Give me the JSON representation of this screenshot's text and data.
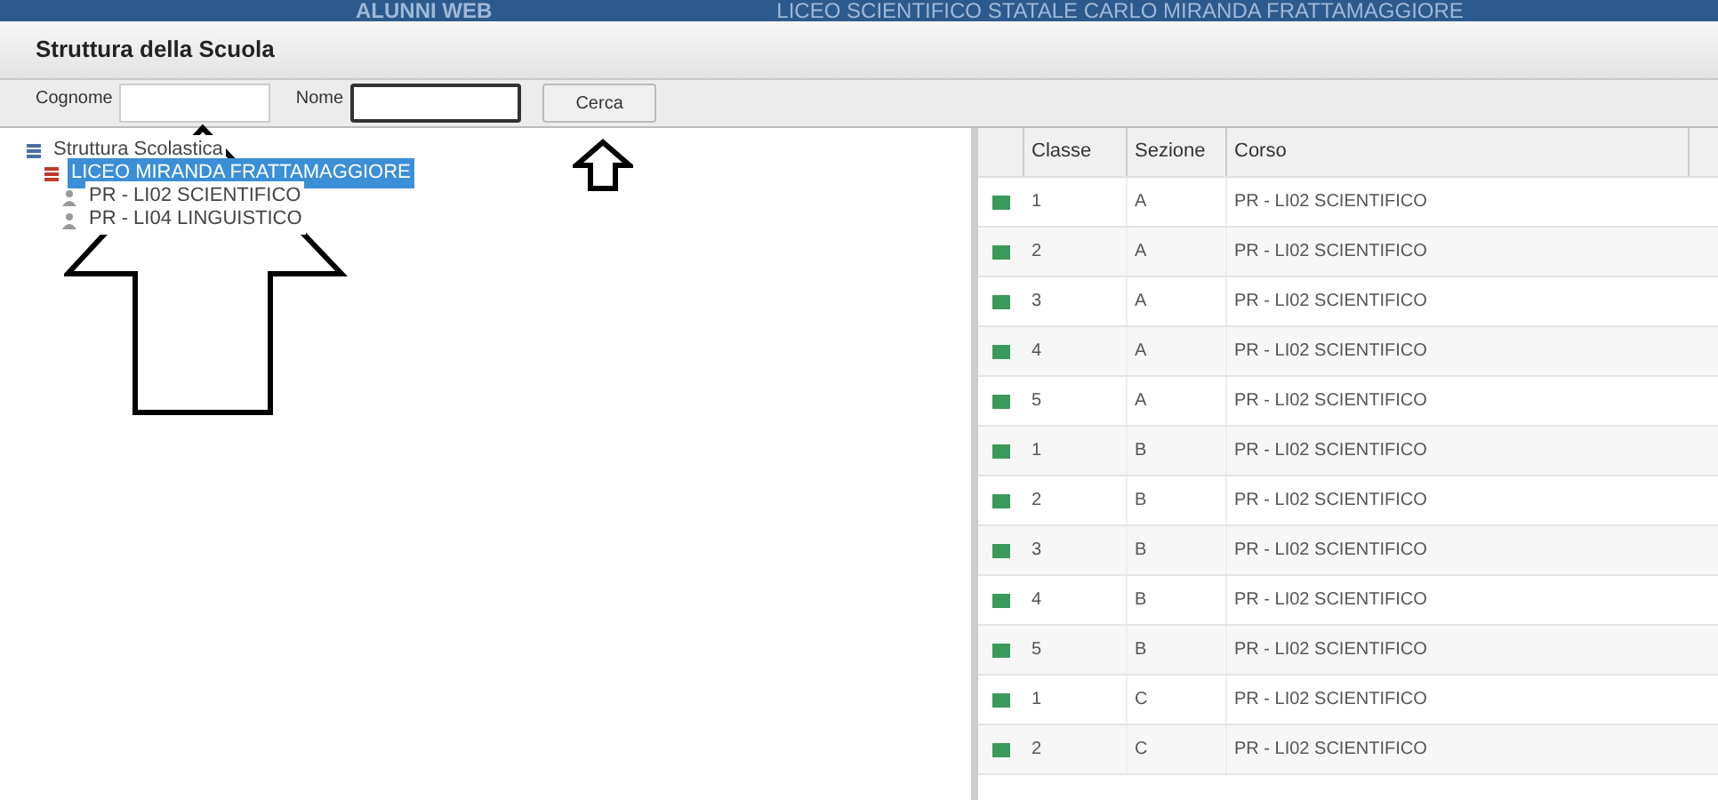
{
  "banner": {
    "app_name": "ALUNNI WEB",
    "school": "LICEO SCIENTIFICO STATALE CARLO MIRANDA  FRATTAMAGGIORE"
  },
  "window": {
    "title": "Struttura della Scuola"
  },
  "search": {
    "surname_label": "Cognome",
    "name_label": "Nome",
    "button": "Cerca"
  },
  "tree": [
    {
      "label": "Struttura Scolastica",
      "kind": "root",
      "selected": false,
      "children": [
        {
          "label": "LICEO MIRANDA FRATTAMAGGIORE",
          "kind": "school",
          "selected": true,
          "children": [
            {
              "label": "PR - LI02 SCIENTIFICO",
              "kind": "course",
              "selected": false
            },
            {
              "label": "PR - LI04 LINGUISTICO",
              "kind": "course",
              "selected": false
            }
          ]
        }
      ]
    }
  ],
  "table": {
    "columns": [
      "Classe",
      "Sezione",
      "Corso"
    ],
    "rows": [
      {
        "classe": "1",
        "sezione": "A",
        "corso": "PR - LI02 SCIENTIFICO"
      },
      {
        "classe": "2",
        "sezione": "A",
        "corso": "PR - LI02 SCIENTIFICO"
      },
      {
        "classe": "3",
        "sezione": "A",
        "corso": "PR - LI02 SCIENTIFICO"
      },
      {
        "classe": "4",
        "sezione": "A",
        "corso": "PR - LI02 SCIENTIFICO"
      },
      {
        "classe": "5",
        "sezione": "A",
        "corso": "PR - LI02 SCIENTIFICO"
      },
      {
        "classe": "1",
        "sezione": "B",
        "corso": "PR - LI02 SCIENTIFICO"
      },
      {
        "classe": "2",
        "sezione": "B",
        "corso": "PR - LI02 SCIENTIFICO"
      },
      {
        "classe": "3",
        "sezione": "B",
        "corso": "PR - LI02 SCIENTIFICO"
      },
      {
        "classe": "4",
        "sezione": "B",
        "corso": "PR - LI02 SCIENTIFICO"
      },
      {
        "classe": "5",
        "sezione": "B",
        "corso": "PR - LI02 SCIENTIFICO"
      },
      {
        "classe": "1",
        "sezione": "C",
        "corso": "PR - LI02 SCIENTIFICO"
      },
      {
        "classe": "2",
        "sezione": "C",
        "corso": "PR - LI02 SCIENTIFICO"
      }
    ]
  }
}
